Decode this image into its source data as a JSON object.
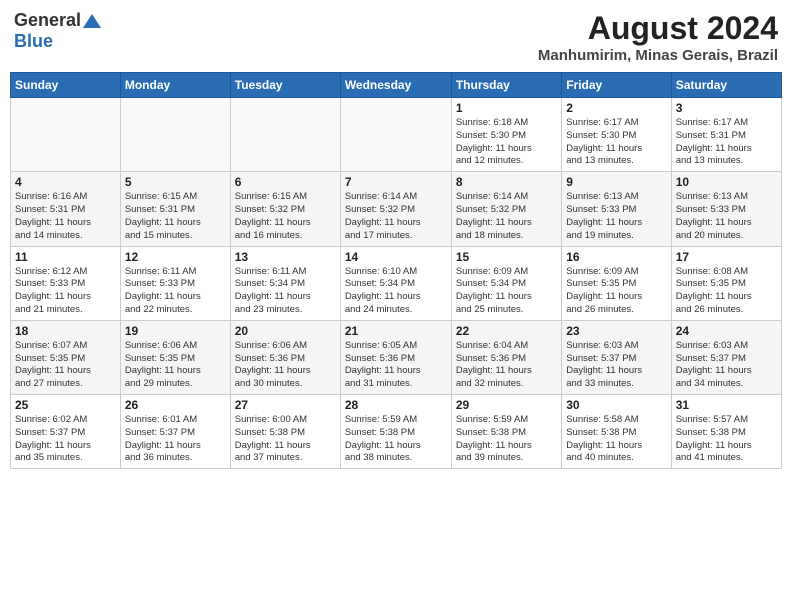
{
  "header": {
    "logo_general": "General",
    "logo_blue": "Blue",
    "title": "August 2024",
    "subtitle": "Manhumirim, Minas Gerais, Brazil"
  },
  "calendar": {
    "weekdays": [
      "Sunday",
      "Monday",
      "Tuesday",
      "Wednesday",
      "Thursday",
      "Friday",
      "Saturday"
    ],
    "weeks": [
      [
        {
          "day": "",
          "info": ""
        },
        {
          "day": "",
          "info": ""
        },
        {
          "day": "",
          "info": ""
        },
        {
          "day": "",
          "info": ""
        },
        {
          "day": "1",
          "info": "Sunrise: 6:18 AM\nSunset: 5:30 PM\nDaylight: 11 hours\nand 12 minutes."
        },
        {
          "day": "2",
          "info": "Sunrise: 6:17 AM\nSunset: 5:30 PM\nDaylight: 11 hours\nand 13 minutes."
        },
        {
          "day": "3",
          "info": "Sunrise: 6:17 AM\nSunset: 5:31 PM\nDaylight: 11 hours\nand 13 minutes."
        }
      ],
      [
        {
          "day": "4",
          "info": "Sunrise: 6:16 AM\nSunset: 5:31 PM\nDaylight: 11 hours\nand 14 minutes."
        },
        {
          "day": "5",
          "info": "Sunrise: 6:15 AM\nSunset: 5:31 PM\nDaylight: 11 hours\nand 15 minutes."
        },
        {
          "day": "6",
          "info": "Sunrise: 6:15 AM\nSunset: 5:32 PM\nDaylight: 11 hours\nand 16 minutes."
        },
        {
          "day": "7",
          "info": "Sunrise: 6:14 AM\nSunset: 5:32 PM\nDaylight: 11 hours\nand 17 minutes."
        },
        {
          "day": "8",
          "info": "Sunrise: 6:14 AM\nSunset: 5:32 PM\nDaylight: 11 hours\nand 18 minutes."
        },
        {
          "day": "9",
          "info": "Sunrise: 6:13 AM\nSunset: 5:33 PM\nDaylight: 11 hours\nand 19 minutes."
        },
        {
          "day": "10",
          "info": "Sunrise: 6:13 AM\nSunset: 5:33 PM\nDaylight: 11 hours\nand 20 minutes."
        }
      ],
      [
        {
          "day": "11",
          "info": "Sunrise: 6:12 AM\nSunset: 5:33 PM\nDaylight: 11 hours\nand 21 minutes."
        },
        {
          "day": "12",
          "info": "Sunrise: 6:11 AM\nSunset: 5:33 PM\nDaylight: 11 hours\nand 22 minutes."
        },
        {
          "day": "13",
          "info": "Sunrise: 6:11 AM\nSunset: 5:34 PM\nDaylight: 11 hours\nand 23 minutes."
        },
        {
          "day": "14",
          "info": "Sunrise: 6:10 AM\nSunset: 5:34 PM\nDaylight: 11 hours\nand 24 minutes."
        },
        {
          "day": "15",
          "info": "Sunrise: 6:09 AM\nSunset: 5:34 PM\nDaylight: 11 hours\nand 25 minutes."
        },
        {
          "day": "16",
          "info": "Sunrise: 6:09 AM\nSunset: 5:35 PM\nDaylight: 11 hours\nand 26 minutes."
        },
        {
          "day": "17",
          "info": "Sunrise: 6:08 AM\nSunset: 5:35 PM\nDaylight: 11 hours\nand 26 minutes."
        }
      ],
      [
        {
          "day": "18",
          "info": "Sunrise: 6:07 AM\nSunset: 5:35 PM\nDaylight: 11 hours\nand 27 minutes."
        },
        {
          "day": "19",
          "info": "Sunrise: 6:06 AM\nSunset: 5:35 PM\nDaylight: 11 hours\nand 29 minutes."
        },
        {
          "day": "20",
          "info": "Sunrise: 6:06 AM\nSunset: 5:36 PM\nDaylight: 11 hours\nand 30 minutes."
        },
        {
          "day": "21",
          "info": "Sunrise: 6:05 AM\nSunset: 5:36 PM\nDaylight: 11 hours\nand 31 minutes."
        },
        {
          "day": "22",
          "info": "Sunrise: 6:04 AM\nSunset: 5:36 PM\nDaylight: 11 hours\nand 32 minutes."
        },
        {
          "day": "23",
          "info": "Sunrise: 6:03 AM\nSunset: 5:37 PM\nDaylight: 11 hours\nand 33 minutes."
        },
        {
          "day": "24",
          "info": "Sunrise: 6:03 AM\nSunset: 5:37 PM\nDaylight: 11 hours\nand 34 minutes."
        }
      ],
      [
        {
          "day": "25",
          "info": "Sunrise: 6:02 AM\nSunset: 5:37 PM\nDaylight: 11 hours\nand 35 minutes."
        },
        {
          "day": "26",
          "info": "Sunrise: 6:01 AM\nSunset: 5:37 PM\nDaylight: 11 hours\nand 36 minutes."
        },
        {
          "day": "27",
          "info": "Sunrise: 6:00 AM\nSunset: 5:38 PM\nDaylight: 11 hours\nand 37 minutes."
        },
        {
          "day": "28",
          "info": "Sunrise: 5:59 AM\nSunset: 5:38 PM\nDaylight: 11 hours\nand 38 minutes."
        },
        {
          "day": "29",
          "info": "Sunrise: 5:59 AM\nSunset: 5:38 PM\nDaylight: 11 hours\nand 39 minutes."
        },
        {
          "day": "30",
          "info": "Sunrise: 5:58 AM\nSunset: 5:38 PM\nDaylight: 11 hours\nand 40 minutes."
        },
        {
          "day": "31",
          "info": "Sunrise: 5:57 AM\nSunset: 5:38 PM\nDaylight: 11 hours\nand 41 minutes."
        }
      ]
    ]
  }
}
